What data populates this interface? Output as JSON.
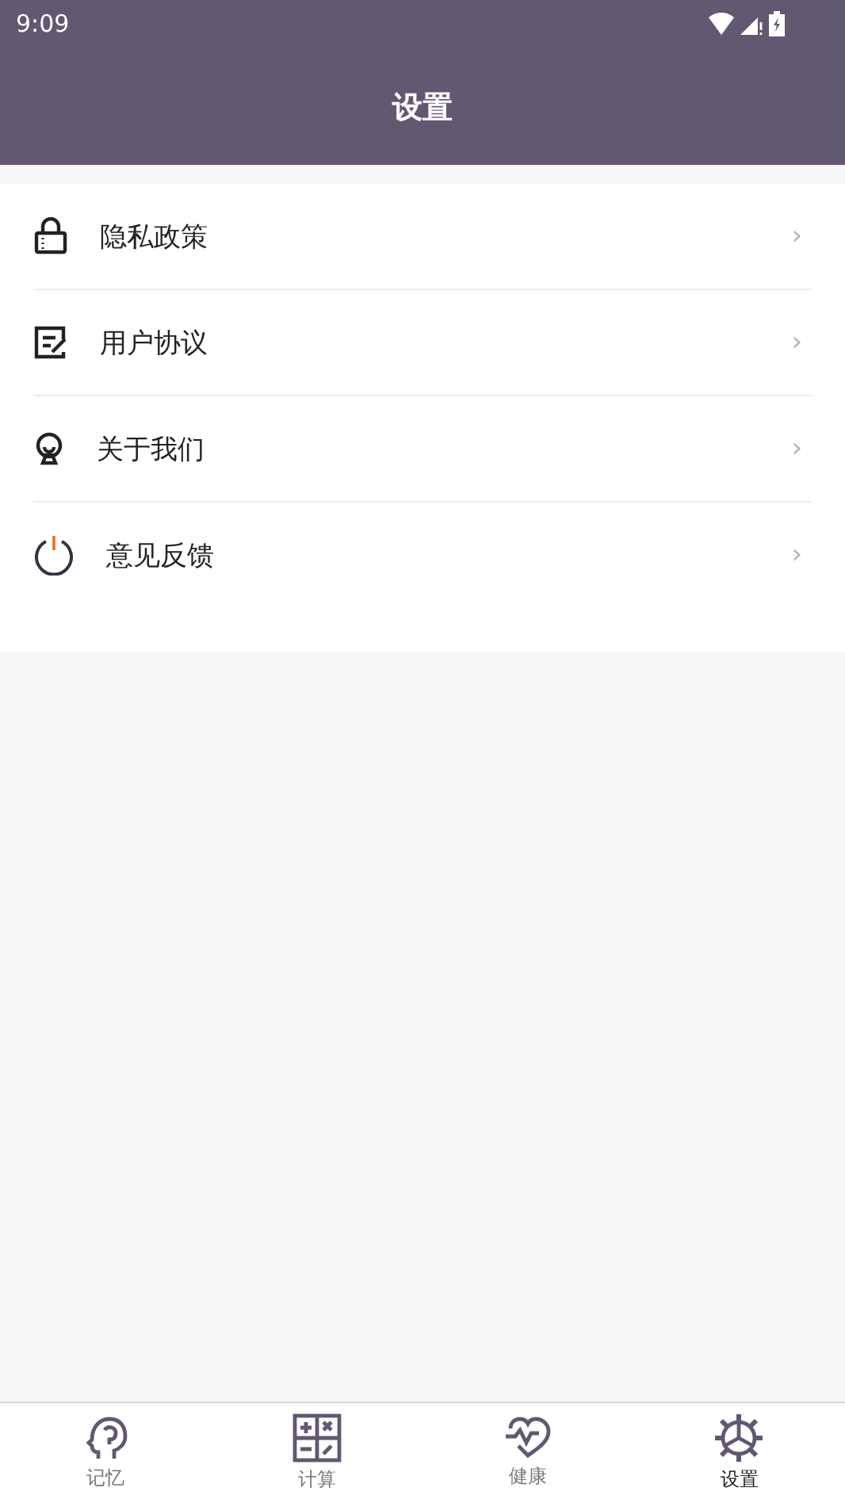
{
  "status_bar": {
    "time": "9:09"
  },
  "header": {
    "title": "设置"
  },
  "menu": [
    {
      "label": "隐私政策",
      "chevron": "›"
    },
    {
      "label": "用户协议",
      "chevron": "›"
    },
    {
      "label": "关于我们",
      "chevron": "›"
    },
    {
      "label": "意见反馈",
      "chevron": "›"
    }
  ],
  "tabs": [
    {
      "label": "记忆",
      "selected": false
    },
    {
      "label": "计算",
      "selected": false
    },
    {
      "label": "健康",
      "selected": false
    },
    {
      "label": "设置",
      "selected": true
    }
  ]
}
